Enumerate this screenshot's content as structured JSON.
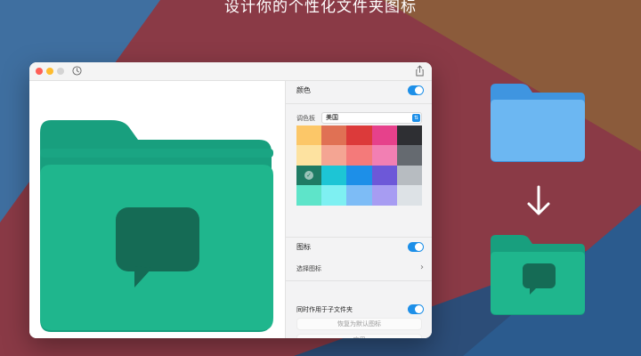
{
  "headline": "设计你的个性化文件夹图标",
  "colors": {
    "accent": "#1d8fe8",
    "folder_green_back": "#189f7e",
    "folder_green_front": "#1fb68d",
    "badge_dark_green": "#156b55",
    "folder_blue_back": "#3f95e0",
    "folder_blue_front": "#6cb7f2"
  },
  "panel": {
    "color_section_label": "颜色",
    "color_enabled": true,
    "palette_label": "调色板",
    "palette_value": "美国",
    "icon_section_label": "图标",
    "icon_enabled": true,
    "choose_icon_label": "选择图标",
    "apply_subfolders_label": "同时作用于子文件夹",
    "apply_subfolders_enabled": true,
    "restore_default_label": "恢复为默认图标",
    "apply_label": "应用"
  },
  "palette": {
    "selected": 10,
    "swatches": [
      "#fcc768",
      "#e07154",
      "#dc3a3a",
      "#e6418b",
      "#2e2f33",
      "#fde2a0",
      "#f4a593",
      "#f47a7a",
      "#f27fb3",
      "#656a70",
      "#1f7b64",
      "#1dc5d5",
      "#1d8fe8",
      "#6d58d8",
      "#b7bcc1",
      "#5ee4c9",
      "#7ef0f2",
      "#7dbcf6",
      "#a79cf2",
      "#dde2e6"
    ]
  },
  "icons": {
    "history": "clock-icon",
    "share": "share-icon",
    "choose_chevron": "chevron-right-icon",
    "badge": "speech-bubble-icon",
    "arrow": "arrow-down-icon"
  }
}
